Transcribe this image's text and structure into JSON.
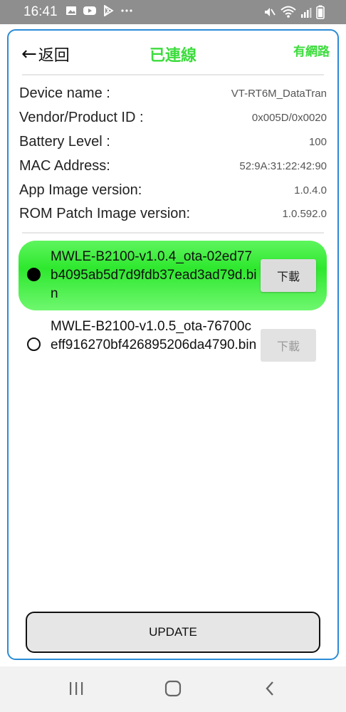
{
  "status_bar": {
    "time": "16:41",
    "left_icons": [
      "gallery-icon",
      "youtube-icon",
      "play-store-icon",
      "more-dots-icon"
    ],
    "right_icons": [
      "mute-icon",
      "wifi-icon",
      "signal-icon",
      "battery-icon"
    ]
  },
  "header": {
    "back_label": "返回",
    "title": "已連線",
    "network_status": "有網路"
  },
  "device_info": [
    {
      "label": "Device name :",
      "value": "VT-RT6M_DataTran"
    },
    {
      "label": "Vendor/Product ID :",
      "value": "0x005D/0x0020"
    },
    {
      "label": "Battery Level :",
      "value": "100"
    },
    {
      "label": "MAC Address:",
      "value": "52:9A:31:22:42:90"
    },
    {
      "label": "App Image version:",
      "value": "1.0.4.0"
    },
    {
      "label": "ROM Patch Image version:",
      "value": "1.0.592.0"
    }
  ],
  "firmware_list": [
    {
      "name": "MWLE-B2100-v1.0.4_ota-02ed77b4095ab5d7d9fdb37ead3ad79d.bin",
      "selected": true,
      "download_label": "下載",
      "download_enabled": true
    },
    {
      "name": "MWLE-B2100-v1.0.5_ota-76700ceff916270bf426895206da4790.bin",
      "selected": false,
      "download_label": "下載",
      "download_enabled": false
    }
  ],
  "update_button": "UPDATE",
  "colors": {
    "accent_green": "#3cdc3c",
    "frame_blue": "#2a8cd6",
    "status_bar": "#8e8e8e"
  },
  "nav_bar": [
    "recent-apps-icon",
    "home-icon",
    "back-icon"
  ]
}
